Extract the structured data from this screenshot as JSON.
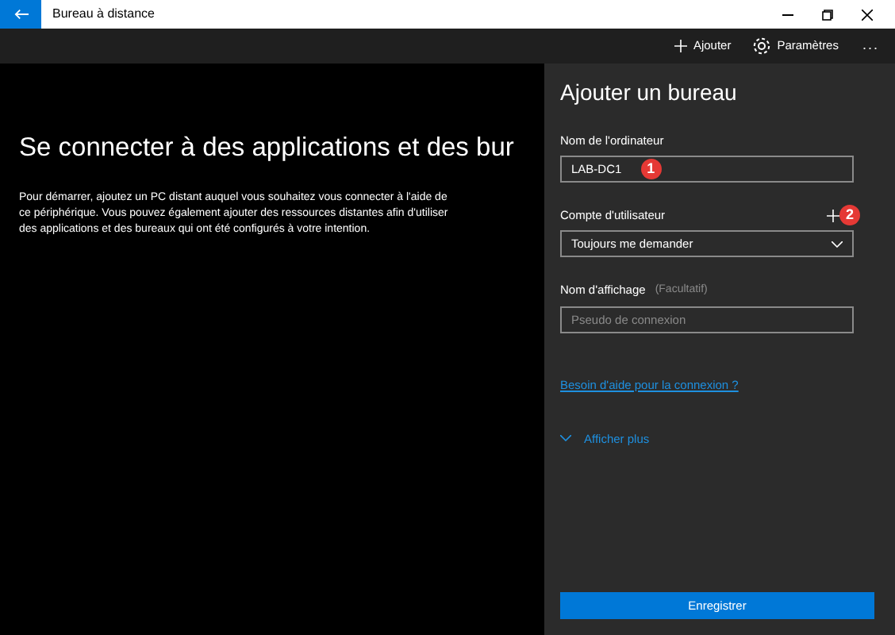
{
  "window": {
    "title": "Bureau à distance"
  },
  "toolbar": {
    "items": [
      {
        "kind": "add",
        "label": "Ajouter"
      },
      {
        "kind": "settings",
        "label": "Paramètres"
      },
      {
        "kind": "more",
        "label": "..."
      }
    ]
  },
  "intro": {
    "heading": "Se connecter à des applications et des bur",
    "body": "Pour démarrer, ajoutez un PC distant auquel vous souhaitez vous connecter à l'aide de ce périphérique. Vous pouvez également ajouter des ressources distantes afin d'utiliser des applications et des bureaux qui ont été configurés à votre intention."
  },
  "panel": {
    "title": "Ajouter un bureau",
    "computer": {
      "label": "Nom de l'ordinateur",
      "value": "LAB-DC1",
      "badge": "1"
    },
    "account": {
      "label": "Compte d'utilisateur",
      "badge": "2",
      "value": "Toujours me demander"
    },
    "display": {
      "label": "Nom d'affichage",
      "hint": "(Facultatif)",
      "placeholder": "Pseudo de connexion"
    },
    "help_link": "Besoin d'aide pour la connexion ?",
    "more": {
      "label": "Afficher plus",
      "expanded": false
    },
    "save": "Enregistrer"
  }
}
